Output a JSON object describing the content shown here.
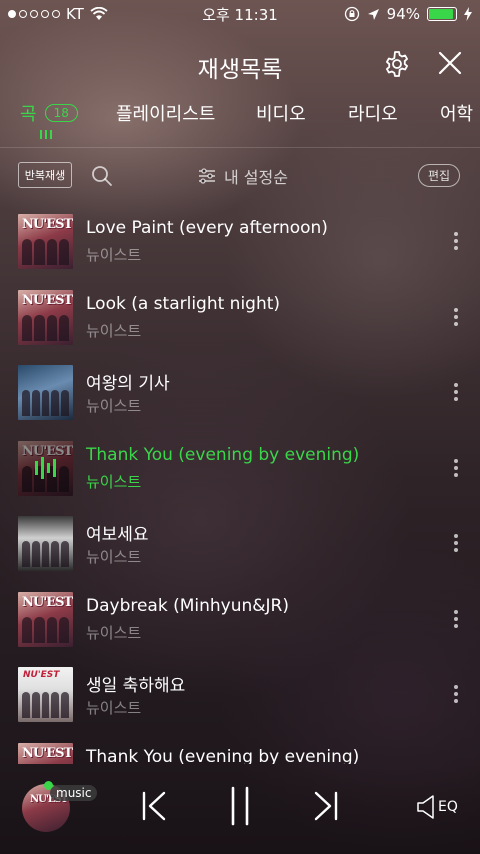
{
  "status_bar": {
    "carrier": "KT",
    "time": "오후 11:31",
    "battery": "94%",
    "battery_level": 0.94
  },
  "header": {
    "title": "재생목록"
  },
  "tabs": [
    {
      "label": "곡",
      "badge": "18",
      "active": true
    },
    {
      "label": "플레이리스트"
    },
    {
      "label": "비디오"
    },
    {
      "label": "라디오"
    },
    {
      "label": "어학"
    }
  ],
  "toolbar": {
    "repeat_label": "반복재생",
    "sort_label": "내 설정순",
    "edit_label": "편집"
  },
  "tracks": [
    {
      "title": "Love Paint (every afternoon)",
      "artist": "뉴이스트",
      "art": "nuest"
    },
    {
      "title": "Look (a starlight night)",
      "artist": "뉴이스트",
      "art": "nuest"
    },
    {
      "title": "여왕의 기사",
      "artist": "뉴이스트",
      "art": "queen"
    },
    {
      "title": "Thank You (evening by evening)",
      "artist": "뉴이스트",
      "art": "nuest",
      "playing": true
    },
    {
      "title": "여보세요",
      "artist": "뉴이스트",
      "art": "hello"
    },
    {
      "title": "Daybreak (Minhyun&JR)",
      "artist": "뉴이스트",
      "art": "nuest"
    },
    {
      "title": "생일 축하해요",
      "artist": "뉴이스트",
      "art": "bday"
    },
    {
      "title": "Thank You (evening by evening)",
      "artist": "",
      "art": "nuest"
    }
  ],
  "player": {
    "tag": "music",
    "eq_label": "EQ"
  },
  "colors": {
    "accent": "#3ad64a"
  }
}
